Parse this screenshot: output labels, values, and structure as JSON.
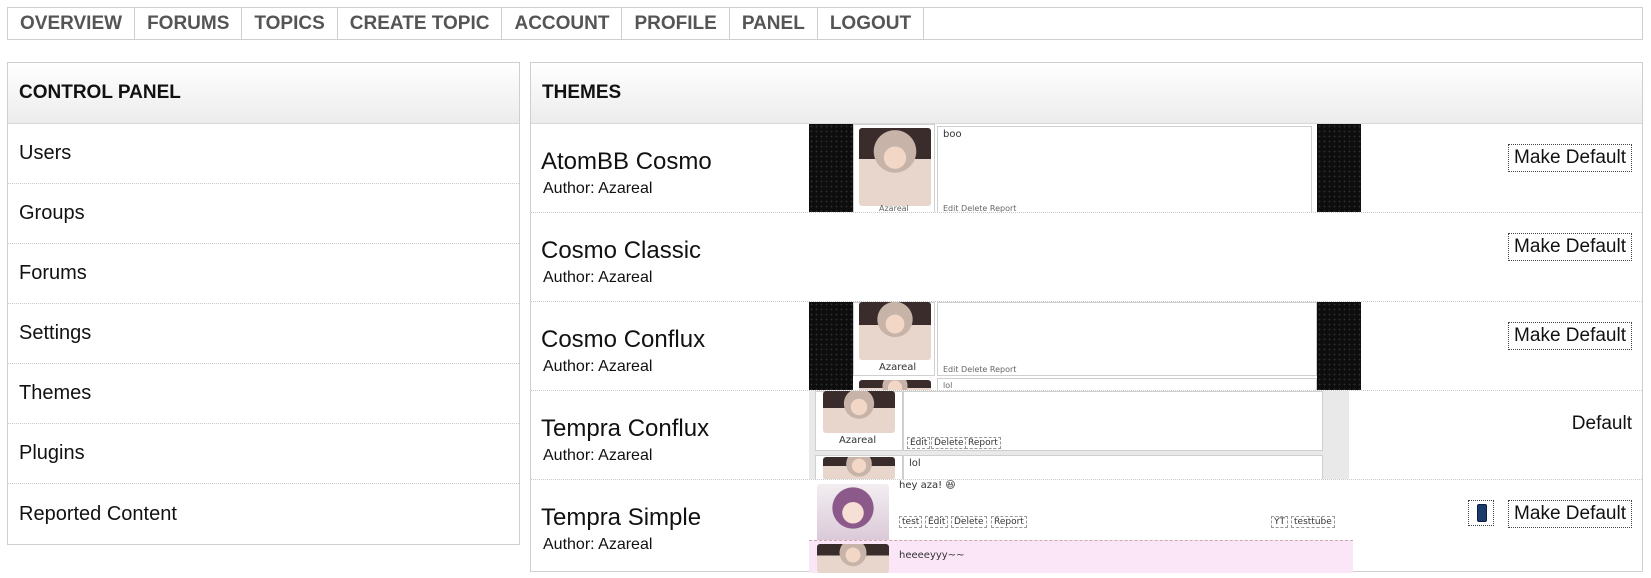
{
  "nav": {
    "items": [
      {
        "key": "overview",
        "label": "OVERVIEW"
      },
      {
        "key": "forums",
        "label": "FORUMS"
      },
      {
        "key": "topics",
        "label": "TOPICS"
      },
      {
        "key": "create_topic",
        "label": "CREATE TOPIC"
      },
      {
        "key": "account",
        "label": "ACCOUNT"
      },
      {
        "key": "profile",
        "label": "PROFILE"
      },
      {
        "key": "panel",
        "label": "PANEL"
      },
      {
        "key": "logout",
        "label": "LOGOUT"
      }
    ]
  },
  "control_panel": {
    "title": "CONTROL PANEL",
    "items": [
      "Users",
      "Groups",
      "Forums",
      "Settings",
      "Themes",
      "Plugins",
      "Reported Content"
    ]
  },
  "themes": {
    "title": "THEMES",
    "make_default_label": "Make Default",
    "default_label": "Default",
    "rows": [
      {
        "name": "AtomBB Cosmo",
        "author": "Author: Azareal",
        "is_default": false,
        "preview": {
          "post_text": "boo",
          "username": "Azareal",
          "actions": "Edit  Delete  Report"
        }
      },
      {
        "name": "Cosmo Classic",
        "author": "Author: Azareal",
        "is_default": false
      },
      {
        "name": "Cosmo Conflux",
        "author": "Author: Azareal",
        "is_default": false,
        "preview": {
          "username": "Azareal",
          "actions": "Edit  Delete  Report",
          "next_text": "lol"
        }
      },
      {
        "name": "Tempra Conflux",
        "author": "Author: Azareal",
        "is_default": true,
        "preview": {
          "username": "Azareal",
          "edit": "Edit",
          "delete": "Delete",
          "report": "Report",
          "next_text": "lol"
        }
      },
      {
        "name": "Tempra Simple",
        "author": "Author: Azareal",
        "is_default": false,
        "has_mobile_icon": true,
        "preview": {
          "post_text": "hey aza! 😆",
          "test": "test",
          "edit": "Edit",
          "delete": "Delete",
          "report": "Report",
          "yt": "YT",
          "testtube": "testtube",
          "reply_text": "heeeeyyy~~"
        }
      }
    ]
  },
  "icons": {
    "mobile": "mobile-phone-icon"
  }
}
